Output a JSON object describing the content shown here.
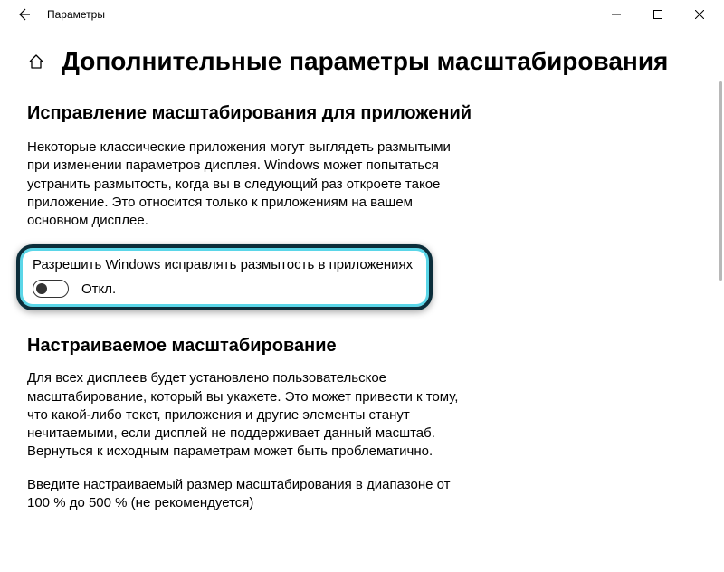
{
  "titlebar": {
    "title": "Параметры"
  },
  "page": {
    "title": "Дополнительные параметры масштабирования"
  },
  "section1": {
    "heading": "Исправление масштабирования для приложений",
    "body": "Некоторые классические приложения могут выглядеть размытыми при изменении параметров дисплея. Windows может попытаться устранить размытость, когда вы в следующий раз откроете такое приложение. Это относится только к приложениям на вашем основном дисплее.",
    "toggle_label": "Разрешить Windows исправлять размытость в приложениях",
    "toggle_status": "Откл."
  },
  "section2": {
    "heading": "Настраиваемое масштабирование",
    "body": "Для всех дисплеев будет установлено пользовательское масштабирование, который вы укажете. Это может привести к тому, что какой-либо текст, приложения и другие элементы станут нечитаемыми, если дисплей не поддерживает данный масштаб. Вернуться к исходным параметрам может быть проблематично.",
    "body2": "Введите настраиваемый размер масштабирования в диапазоне от 100 % до 500 % (не рекомендуется)"
  }
}
